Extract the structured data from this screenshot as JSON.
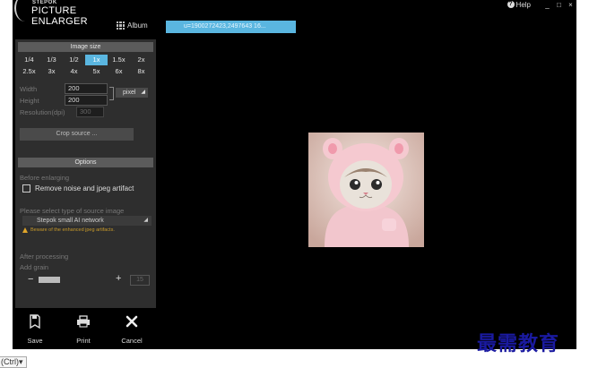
{
  "app": {
    "brand_top": "STEPOK",
    "brand_name": "PICTURE ENLARGER",
    "album_label": "Album",
    "filename": "u=1900272423,2497643 16..."
  },
  "window_controls": {
    "help_label": "Help",
    "minimize": "_",
    "maximize": "□",
    "close": "×"
  },
  "panel": {
    "image_size_header": "Image size",
    "sizes_row1": [
      "1/4",
      "1/3",
      "1/2",
      "1x",
      "1.5x",
      "2x"
    ],
    "sizes_row2": [
      "2.5x",
      "3x",
      "4x",
      "5x",
      "6x",
      "8x"
    ],
    "selected_size": "1x",
    "width_label": "Width",
    "width_value": "200",
    "height_label": "Height",
    "height_value": "200",
    "resolution_label": "Resolution(dpi)",
    "resolution_value": "300",
    "unit_value": "pixel",
    "crop_button": "Crop source ...",
    "options_header": "Options",
    "before_label": "Before enlarging",
    "remove_noise_label": "Remove noise and jpeg artifact",
    "source_type_label": "Please select type of source image",
    "source_type_value": "Stepok small AI network",
    "warning_text": "Beware of the enhanced jpeg artifacts.",
    "after_label": "After processing",
    "add_grain_label": "Add grain",
    "grain_value": "15",
    "grain_minus": "−",
    "grain_plus": "+"
  },
  "actions": {
    "save": "Save",
    "print": "Print",
    "cancel": "Cancel"
  },
  "overlay": {
    "watermark": "最需教育",
    "ctrl_tag": "(Ctrl)▾"
  },
  "colors": {
    "accent": "#5ab6e0",
    "panel_bg": "#2e2e2e",
    "header_bg": "#5b5b5b",
    "watermark": "#1a1aa0"
  }
}
